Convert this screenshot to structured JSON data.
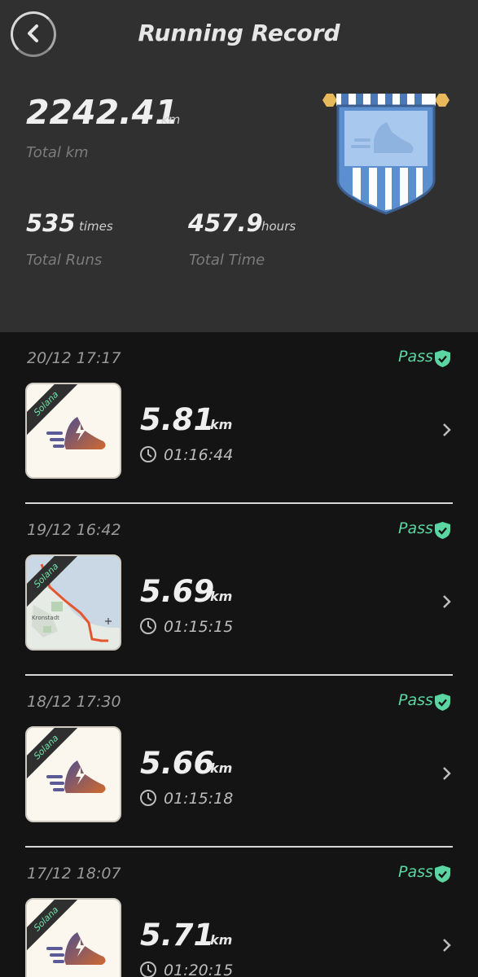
{
  "header": {
    "title": "Running Record",
    "total_km_value": "2242.41",
    "total_km_unit": "km",
    "total_km_label": "Total km",
    "runs_value": "535",
    "runs_unit": "times",
    "runs_label": "Total Runs",
    "time_value": "457.9",
    "time_unit": "hours",
    "time_label": "Total Time"
  },
  "records": [
    {
      "date": "20/12 17:17",
      "status": "Pass",
      "tag": "Solana",
      "distance": "5.81",
      "unit": "km",
      "duration": "01:16:44",
      "thumb": "shoe"
    },
    {
      "date": "19/12 16:42",
      "status": "Pass",
      "tag": "Solana",
      "distance": "5.69",
      "unit": "km",
      "duration": "01:15:15",
      "thumb": "map",
      "map_label": "Kronstadt"
    },
    {
      "date": "18/12 17:30",
      "status": "Pass",
      "tag": "Solana",
      "distance": "5.66",
      "unit": "km",
      "duration": "01:15:18",
      "thumb": "shoe"
    },
    {
      "date": "17/12 18:07",
      "status": "Pass",
      "tag": "Solana",
      "distance": "5.71",
      "unit": "km",
      "duration": "01:20:15",
      "thumb": "shoe"
    }
  ],
  "colors": {
    "header_bg": "#303030",
    "list_bg": "#141414",
    "pass_green": "#5bd6a2",
    "badge_blue": "#5b8fd0"
  },
  "icons": [
    "back-arrow-icon",
    "badge-shield-icon",
    "pass-shield-icon",
    "shoe-icon",
    "clock-icon",
    "chevron-right-icon"
  ]
}
